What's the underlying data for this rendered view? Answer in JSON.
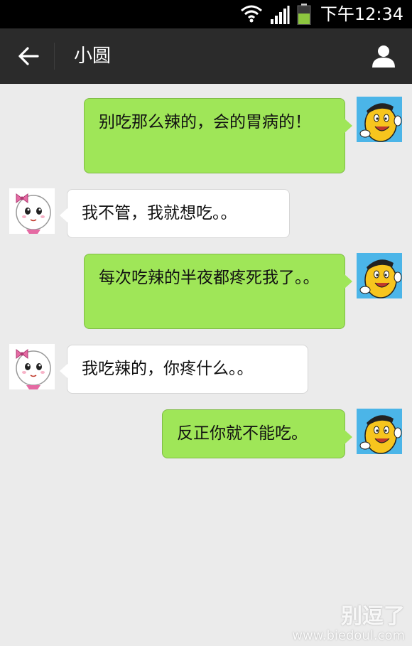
{
  "status_bar": {
    "time": "下午12:34",
    "icons": [
      "wifi-icon",
      "signal-icon",
      "battery-icon"
    ],
    "battery_color": "#8dc63f"
  },
  "header": {
    "title": "小圆",
    "back_icon": "arrow-left-icon",
    "profile_icon": "person-icon"
  },
  "colors": {
    "outgoing_bubble": "#9fe658",
    "incoming_bubble": "#ffffff",
    "chat_background": "#ebebeb",
    "header_background": "#2b2b2b"
  },
  "messages": [
    {
      "direction": "outgoing",
      "avatar": "yellow-bean-avatar",
      "text": "别吃那么辣的，会的胃病的！"
    },
    {
      "direction": "incoming",
      "avatar": "cartoon-girl-avatar",
      "text": "我不管，我就想吃。。"
    },
    {
      "direction": "outgoing",
      "avatar": "yellow-bean-avatar",
      "text": "每次吃辣的半夜都疼死我了。。"
    },
    {
      "direction": "incoming",
      "avatar": "cartoon-girl-avatar",
      "text": "我吃辣的，你疼什么。。"
    },
    {
      "direction": "outgoing",
      "avatar": "yellow-bean-avatar",
      "text": "反正你就不能吃。"
    }
  ],
  "watermark": {
    "brand": "别逗了",
    "url": "www.biedoul.com"
  }
}
